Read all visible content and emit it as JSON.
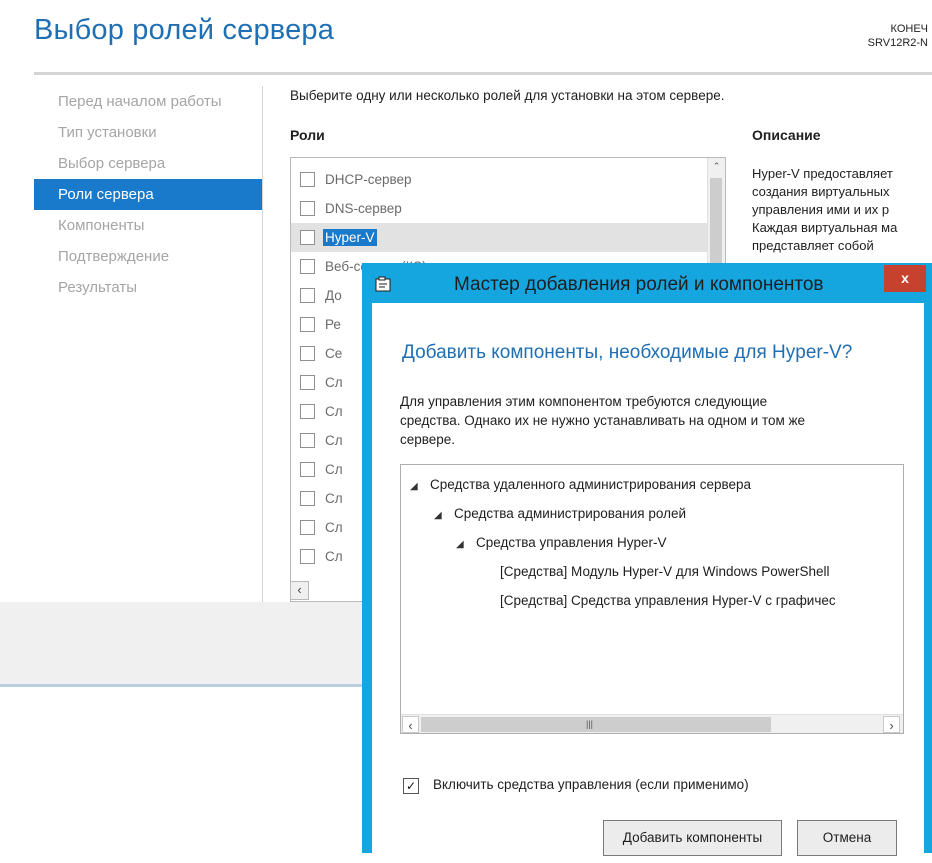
{
  "wizard": {
    "title": "Выбор ролей сервера",
    "destination": {
      "line1": "КОНЕЧ",
      "line2": "SRV12R2-N"
    },
    "nav": [
      {
        "label": "Перед началом работы",
        "active": false
      },
      {
        "label": "Тип установки",
        "active": false
      },
      {
        "label": "Выбор сервера",
        "active": false
      },
      {
        "label": "Роли сервера",
        "active": true
      },
      {
        "label": "Компоненты",
        "active": false
      },
      {
        "label": "Подтверждение",
        "active": false
      },
      {
        "label": "Результаты",
        "active": false
      }
    ],
    "instruction": "Выберите одну или несколько ролей для установки на этом сервере.",
    "roles_heading": "Роли",
    "roles": [
      {
        "label": "DHCP-сервер",
        "checked": false
      },
      {
        "label": "DNS-сервер",
        "checked": false
      },
      {
        "label": "Hyper-V",
        "checked": false,
        "selected": true
      },
      {
        "label": "Веб-сервер (IIS)",
        "checked": false
      },
      {
        "label": "До",
        "checked": false
      },
      {
        "label": "Ре",
        "checked": false
      },
      {
        "label": "Се",
        "checked": false
      },
      {
        "label": "Сл",
        "checked": false
      },
      {
        "label": "Сл",
        "checked": false
      },
      {
        "label": "Сл",
        "checked": false
      },
      {
        "label": "Сл",
        "checked": false
      },
      {
        "label": "Сл",
        "checked": false
      },
      {
        "label": "Сл",
        "checked": false
      },
      {
        "label": "Сл",
        "checked": false
      }
    ],
    "description_heading": "Описание",
    "description_lines": [
      "Hyper-V предоставляет",
      "создания виртуальных",
      "управления ими и их р",
      "Каждая виртуальная ма",
      "представляет собой"
    ]
  },
  "dialog": {
    "title": "Мастер добавления ролей и компонентов",
    "close_label": "x",
    "heading": "Добавить компоненты, необходимые для Hyper-V?",
    "text_lines": [
      "Для управления этим компонентом требуются следующие",
      "средства. Однако их не нужно устанавливать на одном и том же",
      "сервере."
    ],
    "tree": [
      {
        "label": "Средства удаленного администрирования сервера",
        "level": 0,
        "expanded": true
      },
      {
        "label": "Средства администрирования ролей",
        "level": 1,
        "expanded": true
      },
      {
        "label": "Средства управления Hyper-V",
        "level": 2,
        "expanded": true
      },
      {
        "label": "[Средства] Модуль Hyper-V для Windows PowerShell",
        "level": 3,
        "expanded": false
      },
      {
        "label": "[Средства] Средства управления Hyper-V с графичес",
        "level": 3,
        "expanded": false
      }
    ],
    "include_tools_label": "Включить средства управления (если применимо)",
    "include_tools_checked": true,
    "add_button": "Добавить компоненты",
    "cancel_button": "Отмена"
  }
}
